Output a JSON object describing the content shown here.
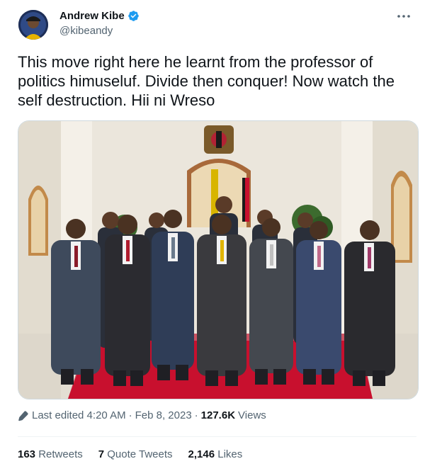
{
  "author": {
    "display_name": "Andrew Kibe",
    "handle": "@kibeandy",
    "verified": true,
    "avatar_icon": "avatar-image"
  },
  "tweet": {
    "text": "This move right here he learnt from the professor of politics himuseluf. Divide then conquer! Now watch the self destruction. Hii ni Wreso",
    "media_icon": "group-photo"
  },
  "meta": {
    "edited_label": "Last edited 4:20 AM",
    "separator": "·",
    "date": "Feb 8, 2023",
    "views_count": "127.6K",
    "views_label": "Views"
  },
  "stats": {
    "retweets_count": "163",
    "retweets_label": "Retweets",
    "quotes_count": "7",
    "quotes_label": "Quote Tweets",
    "likes_count": "2,146",
    "likes_label": "Likes"
  },
  "colors": {
    "text": "#0f1419",
    "secondary": "#536471",
    "verified": "#1d9bf0",
    "carpet": "#c8102e"
  }
}
